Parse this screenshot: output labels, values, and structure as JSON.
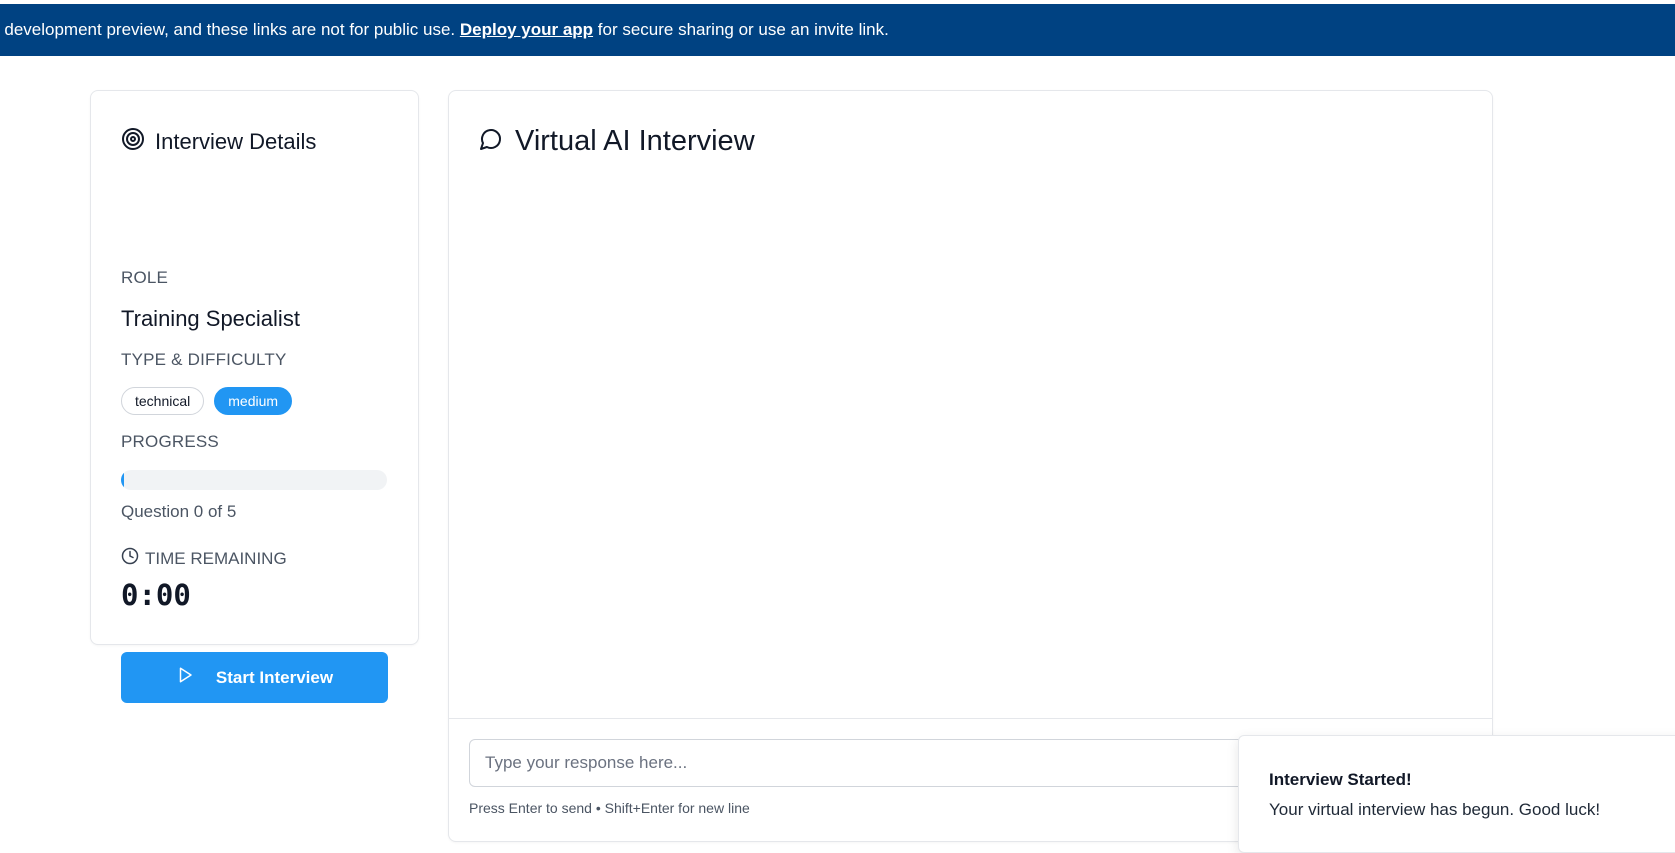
{
  "banner": {
    "text_before": "r development preview, and these links are not for public use. ",
    "link_text": "Deploy your app",
    "text_after": " for secure sharing or use an invite link."
  },
  "details": {
    "title": "Interview Details",
    "role_label": "ROLE",
    "role_value": "Training Specialist",
    "type_label": "TYPE & DIFFICULTY",
    "type_badge": "technical",
    "difficulty_badge": "medium",
    "progress_label": "PROGRESS",
    "progress_fraction": 0,
    "question_count": "Question 0 of 5",
    "time_label": "TIME REMAINING",
    "timer": "0:00",
    "start_button": "Start Interview"
  },
  "chat": {
    "title": "Virtual AI Interview",
    "input_placeholder": "Type your response here...",
    "hint": "Press Enter to send • Shift+Enter for new line"
  },
  "toast": {
    "title": "Interview Started!",
    "body": "Your virtual interview has begun. Good luck!"
  },
  "colors": {
    "banner_bg": "#004282",
    "accent": "#2196f3"
  },
  "icons": {
    "details_header": "target-icon",
    "time": "clock-icon",
    "start": "play-icon",
    "chat_header": "message-circle-icon"
  }
}
